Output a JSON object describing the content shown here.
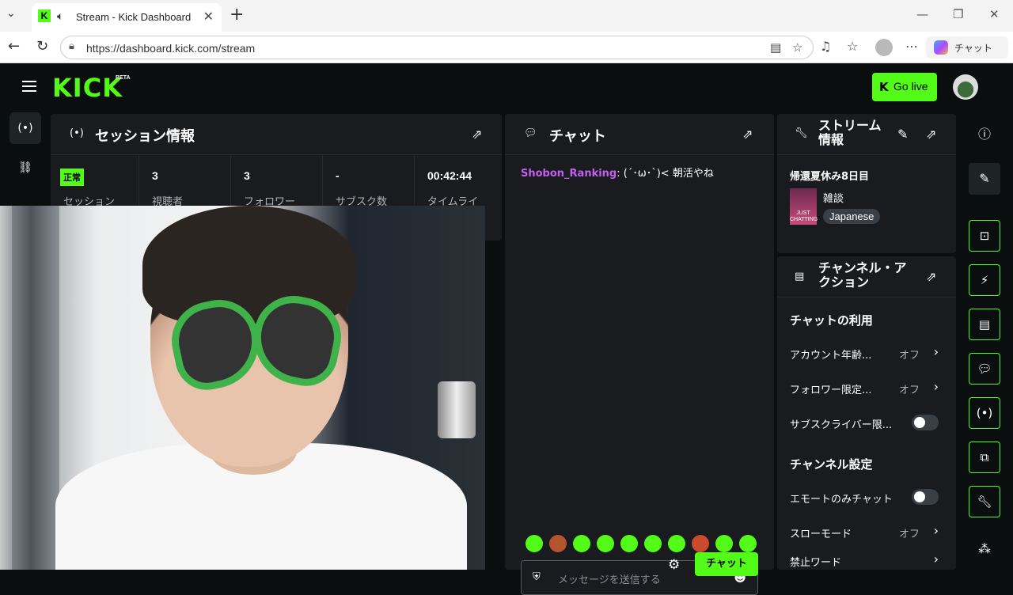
{
  "browser": {
    "tab_title": "Stream - Kick Dashboard",
    "url": "https://dashboard.kick.com/stream",
    "copilot_label": "チャット"
  },
  "header": {
    "logo": "KICK",
    "beta": "BETA",
    "go_live": "Go live",
    "brand_color": "#53fc18"
  },
  "session": {
    "title": "セッション情報",
    "stats": [
      {
        "value": "正常",
        "label": "セッション"
      },
      {
        "value": "3",
        "label": "視聴者"
      },
      {
        "value": "3",
        "label": "フォロワー"
      },
      {
        "value": "-",
        "label": "サブスク数"
      },
      {
        "value": "00:42:44",
        "label": "タイムライ"
      }
    ]
  },
  "chat": {
    "title": "チャット",
    "messages": [
      {
        "user": "Shobon_Ranking",
        "text": "(´･ω･`)< 朝活やね"
      }
    ],
    "input_placeholder": "メッセージを送信する",
    "send_label": "チャット"
  },
  "stream_info": {
    "title_line1": "ストリーム",
    "title_line2": "情報",
    "stream_title": "帰還夏休み8日目",
    "category": "雑談",
    "category_thumb": "JUST CHATTING",
    "language": "Japanese"
  },
  "channel_actions": {
    "title_line1": "チャンネル・ア",
    "title_line2": "クション",
    "chat_section": "チャットの利用",
    "rows": [
      {
        "label": "アカウント年齢...",
        "state": "オフ"
      },
      {
        "label": "フォロワー限定...",
        "state": "オフ"
      },
      {
        "label": "サブスクライバー限..."
      }
    ],
    "channel_section": "チャンネル設定",
    "rows2": [
      {
        "label": "エモートのみチャット"
      },
      {
        "label": "スローモード",
        "state": "オフ"
      },
      {
        "label": "禁止ワード"
      }
    ]
  }
}
